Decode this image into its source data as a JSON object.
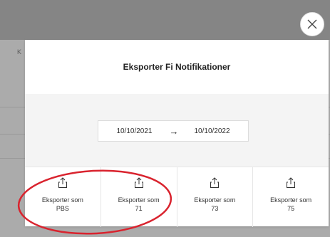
{
  "background": {
    "column_fragment": "K"
  },
  "modal": {
    "title": "Eksporter Fi Notifikationer",
    "date_from": "10/10/2021",
    "date_to": "10/10/2022",
    "arrow": "→",
    "options": [
      {
        "line1": "Eksporter som",
        "line2": "PBS"
      },
      {
        "line1": "Eksporter som",
        "line2": "71"
      },
      {
        "line1": "Eksporter som",
        "line2": "73"
      },
      {
        "line1": "Eksporter som",
        "line2": "75"
      }
    ]
  },
  "colors": {
    "annotation": "#d9232e",
    "modal_body": "#f4f4f4"
  },
  "icons": {
    "close": "close-icon",
    "export": "share-export-icon"
  }
}
